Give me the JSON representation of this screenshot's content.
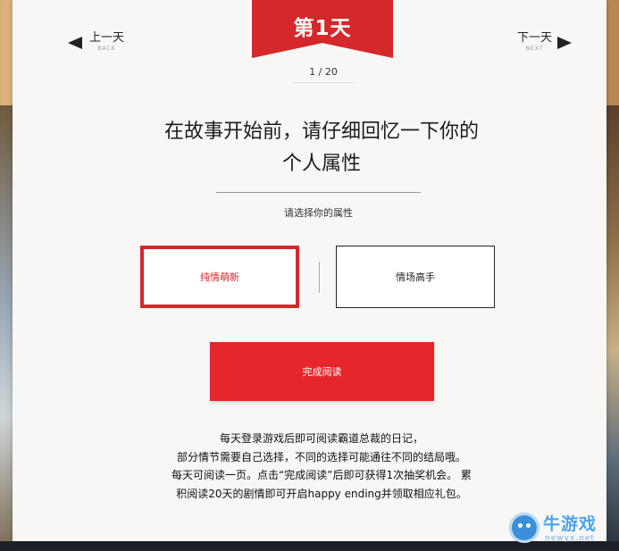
{
  "ribbon": {
    "day_label": "第1天"
  },
  "pager": {
    "counter": "1 / 20"
  },
  "nav": {
    "prev_label": "上一天",
    "prev_sub": "BACK",
    "next_label": "下一天",
    "next_sub": "NEXT"
  },
  "main": {
    "title_line1": "在故事开始前，请仔细回忆一下你的",
    "title_line2": "个人属性",
    "prompt": "请选择你的属性",
    "options": [
      {
        "label": "纯情萌新",
        "selected": true
      },
      {
        "label": "情场高手",
        "selected": false
      }
    ],
    "finish_label": "完成阅读",
    "description": [
      "每天登录游戏后即可阅读霸道总裁的日记，",
      "部分情节需要自己选择，不同的选择可能通往不同的结局哦。",
      "每天可阅读一页。点击“完成阅读”后即可获得1次抽奖机会。 累",
      "积阅读20天的剧情即可开启happy ending并领取相应礼包。"
    ]
  },
  "watermark": {
    "name": "牛游戏",
    "url": "newyx.net"
  },
  "colors": {
    "accent": "#d4282a",
    "button": "#e5262c",
    "card": "#f8f7f6"
  }
}
